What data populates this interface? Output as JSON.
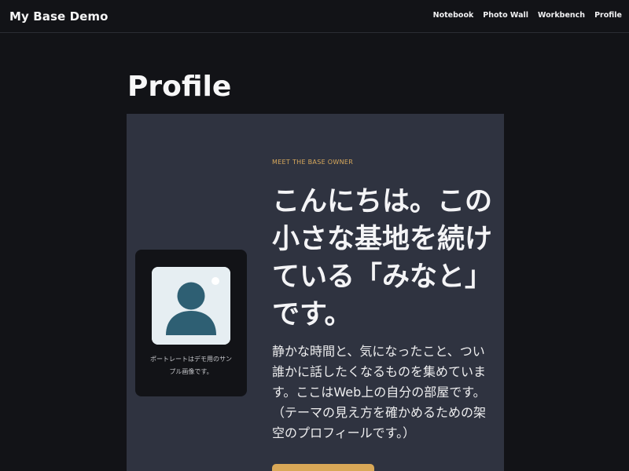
{
  "header": {
    "brand": "My Base Demo",
    "nav": [
      "Notebook",
      "Photo Wall",
      "Workbench",
      "Profile"
    ]
  },
  "page": {
    "title": "Profile"
  },
  "portrait": {
    "icon": "person-avatar-icon",
    "caption": "ポートレートはデモ用のサンプル画像です。"
  },
  "hero": {
    "eyebrow": "MEET THE BASE OWNER",
    "title": "こんにちは。この小さな基地を続けている「みなと」です。",
    "body": "静かな時間と、気になったこと、つい誰かに話したくなるものを集めています。ここはWeb上の自分の部屋です。（テーマの見え方を確かめるための架空のプロフィールです。）"
  },
  "colors": {
    "background": "#121317",
    "panel": "#2f3340",
    "accent": "#d9a857",
    "avatar_bg": "#e6eef2",
    "avatar_figure": "#2e5f73"
  }
}
